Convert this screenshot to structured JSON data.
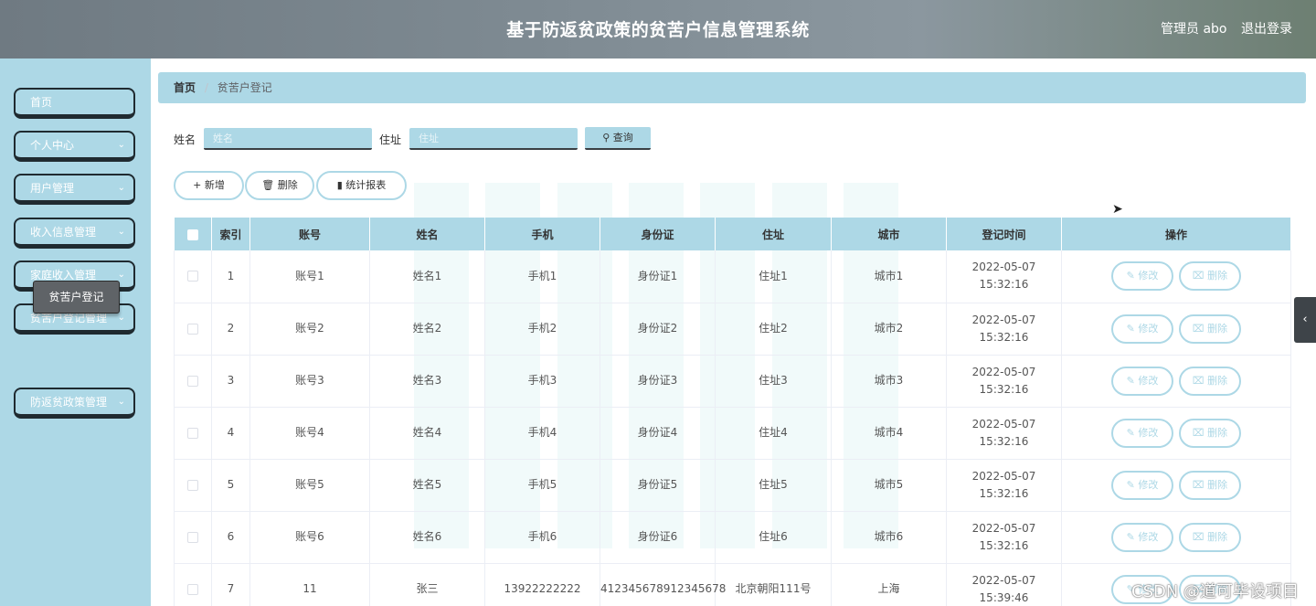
{
  "header": {
    "title": "基于防返贫政策的贫苦户信息管理系统",
    "admin": "管理员 abo",
    "logout": "退出登录"
  },
  "sidebar": {
    "items": [
      {
        "label": "首页",
        "has_children": false
      },
      {
        "label": "个人中心",
        "has_children": true
      },
      {
        "label": "用户管理",
        "has_children": true
      },
      {
        "label": "收入信息管理",
        "has_children": true
      },
      {
        "label": "家庭收入管理",
        "has_children": true
      },
      {
        "label": "贫苦户登记管理",
        "has_children": true
      },
      {
        "label": "防返贫政策管理",
        "has_children": true
      }
    ],
    "active_submenu": "贫苦户登记",
    "chevron": "chevron-down-icon"
  },
  "breadcrumb": {
    "home": "首页",
    "separator": "/",
    "current": "贫苦户登记"
  },
  "search": {
    "name_label": "姓名",
    "name_placeholder": "姓名",
    "address_label": "住址",
    "address_placeholder": "住址",
    "query_label": "查询"
  },
  "actions": {
    "add": "新增",
    "delete": "删除",
    "report": "统计报表"
  },
  "table": {
    "columns": [
      "索引",
      "账号",
      "姓名",
      "手机",
      "身份证",
      "住址",
      "城市",
      "登记时间",
      "操作"
    ],
    "rows": [
      {
        "index": "1",
        "account": "账号1",
        "name": "姓名1",
        "phone": "手机1",
        "id": "身份证1",
        "address": "住址1",
        "city": "城市1",
        "time": "2022-05-07 15:32:16"
      },
      {
        "index": "2",
        "account": "账号2",
        "name": "姓名2",
        "phone": "手机2",
        "id": "身份证2",
        "address": "住址2",
        "city": "城市2",
        "time": "2022-05-07 15:32:16"
      },
      {
        "index": "3",
        "account": "账号3",
        "name": "姓名3",
        "phone": "手机3",
        "id": "身份证3",
        "address": "住址3",
        "city": "城市3",
        "time": "2022-05-07 15:32:16"
      },
      {
        "index": "4",
        "account": "账号4",
        "name": "姓名4",
        "phone": "手机4",
        "id": "身份证4",
        "address": "住址4",
        "city": "城市4",
        "time": "2022-05-07 15:32:16"
      },
      {
        "index": "5",
        "account": "账号5",
        "name": "姓名5",
        "phone": "手机5",
        "id": "身份证5",
        "address": "住址5",
        "city": "城市5",
        "time": "2022-05-07 15:32:16"
      },
      {
        "index": "6",
        "account": "账号6",
        "name": "姓名6",
        "phone": "手机6",
        "id": "身份证6",
        "address": "住址6",
        "city": "城市6",
        "time": "2022-05-07 15:32:16"
      },
      {
        "index": "7",
        "account": "11",
        "name": "张三",
        "phone": "13922222222",
        "id": "412345678912345678",
        "address": "北京朝阳111号",
        "city": "上海",
        "time": "2022-05-07 15:39:46"
      }
    ],
    "edit_label": "修改",
    "delete_label": "删除"
  },
  "side_tab": "‹",
  "watermark": "CSDN @道可毕设项目",
  "colors": {
    "accent": "#add8e6",
    "header": "#7e8a92",
    "submenu_active": "#5f6367"
  }
}
